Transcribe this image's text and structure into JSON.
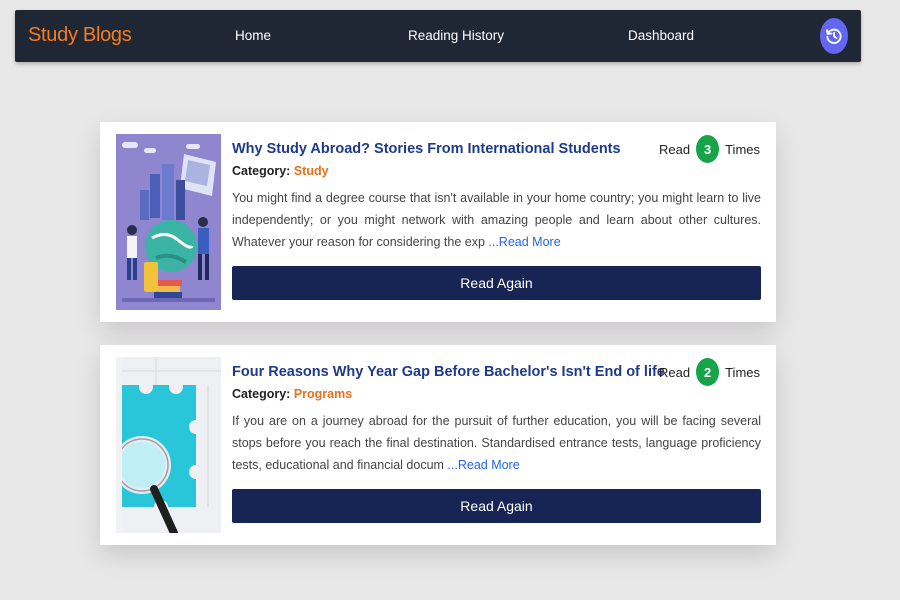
{
  "navbar": {
    "brand": "Study Blogs",
    "links": [
      "Home",
      "Reading History",
      "Dashboard"
    ]
  },
  "colors": {
    "brand": "#f57c1f",
    "navbar_bg": "#1f2634",
    "title": "#1e3a8a",
    "category": "#e8711b",
    "badge": "#16a34a",
    "button": "#172554",
    "history_button": "#6366f1"
  },
  "icons": {
    "history_button": "history-icon"
  },
  "posts": [
    {
      "title": "Why Study Abroad? Stories From International Students",
      "category_label": "Category:",
      "category": "Study",
      "excerpt": "You might find a degree course that isn't available in your home country; you might learn to live independently; or you might network with amazing people and learn about other cultures. Whatever your reason for considering the exp ",
      "read_more": "...Read More",
      "read_prefix": "Read",
      "read_count": "3",
      "read_suffix": "Times",
      "button": "Read Again"
    },
    {
      "title": "Four Reasons Why Year Gap Before Bachelor's Isn't End of life",
      "category_label": "Category:",
      "category": "Programs",
      "excerpt": "If you are on a journey abroad for the pursuit of further education, you will be facing several stops before you reach the final destination. Standardised entrance tests, language proficiency tests, educational and financial docum ",
      "read_more": "...Read More",
      "read_prefix": "Read",
      "read_count": "2",
      "read_suffix": "Times",
      "button": "Read Again"
    }
  ]
}
